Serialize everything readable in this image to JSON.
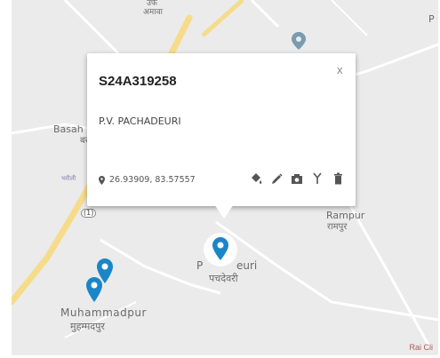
{
  "map": {
    "labels": {
      "top_hindi": "उर्फ",
      "amawa_hindi": "अमावा",
      "basahi": "Basah",
      "basahi_hindi": "बस",
      "small_hindi": "भरौली",
      "rampur": "Rampur",
      "rampur_hindi": "रामपुर",
      "pachadeuri_a": "P",
      "pachadeuri_b": "euri",
      "pachadeuri_hindi": "पचदेवरी",
      "muhammadpur": "Muhammadpur",
      "muhammadpur_hindi": "मुहम्मदपुर",
      "road_shield": "(1)",
      "corner_p": "P",
      "footer_link": "Rai Cli"
    },
    "colors": {
      "land": "#ebebeb",
      "road_major": "#f6dc8a",
      "road_minor": "#ffffff",
      "pin": "#1a86c7"
    },
    "markers": [
      {
        "id": "selected",
        "selected": true
      },
      {
        "id": "muhammadpur-1",
        "selected": false
      },
      {
        "id": "muhammadpur-2",
        "selected": false
      }
    ]
  },
  "popup": {
    "title": "S24A319258",
    "close_label": "x",
    "place_name": "P.V. PACHADEURI",
    "coordinates": "26.93909, 83.57557",
    "actions": [
      "paint-bucket-icon",
      "pencil-icon",
      "camera-icon",
      "fork-icon",
      "trash-icon"
    ]
  }
}
